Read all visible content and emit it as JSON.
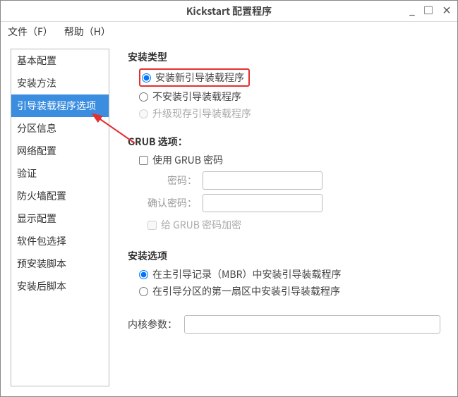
{
  "window": {
    "title": "Kickstart 配置程序",
    "minimize": "_",
    "maximize": "□",
    "close": "×"
  },
  "menubar": {
    "file": "文件（F）",
    "help": "帮助（H）"
  },
  "sidebar": {
    "items": [
      {
        "label": "基本配置",
        "selected": false
      },
      {
        "label": "安装方法",
        "selected": false
      },
      {
        "label": "引导装载程序选项",
        "selected": true
      },
      {
        "label": "分区信息",
        "selected": false
      },
      {
        "label": "网络配置",
        "selected": false
      },
      {
        "label": "验证",
        "selected": false
      },
      {
        "label": "防火墙配置",
        "selected": false
      },
      {
        "label": "显示配置",
        "selected": false
      },
      {
        "label": "软件包选择",
        "selected": false
      },
      {
        "label": "预安装脚本",
        "selected": false
      },
      {
        "label": "安装后脚本",
        "selected": false
      }
    ]
  },
  "install_type": {
    "title": "安装类型",
    "opt_new": "安装新引导装载程序",
    "opt_none": "不安装引导装载程序",
    "opt_upgrade": "升级现存引导装载程序"
  },
  "grub": {
    "title": "GRUB 选项：",
    "use_password": "使用 GRUB 密码",
    "password_label": "密码：",
    "password_value": "",
    "confirm_label": "确认密码：",
    "confirm_value": "",
    "encrypt_label": "给 GRUB 密码加密"
  },
  "install_options": {
    "title": "安装选项",
    "opt_mbr": "在主引导记录（MBR）中安装引导装载程序",
    "opt_first_sector": "在引导分区的第一扇区中安装引导装载程序"
  },
  "kernel": {
    "label": "内核参数：",
    "value": ""
  }
}
